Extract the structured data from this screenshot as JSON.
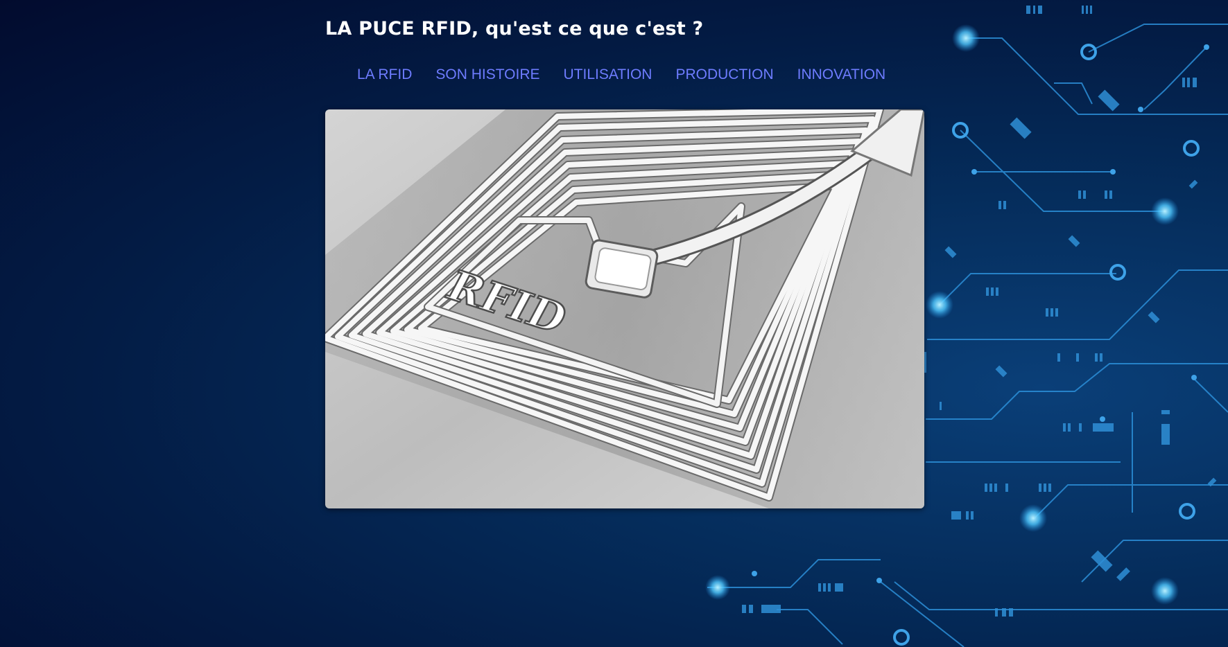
{
  "site": {
    "title": "LA PUCE RFID, qu'est ce que c'est ?"
  },
  "nav": {
    "items": [
      {
        "label": "LA RFID"
      },
      {
        "label": "SON HISTOIRE"
      },
      {
        "label": "UTILISATION"
      },
      {
        "label": "PRODUCTION"
      },
      {
        "label": "INNOVATION"
      }
    ]
  },
  "hero": {
    "tag_text": "RFID"
  },
  "colors": {
    "nav_link": "#6e7cff",
    "title": "#ffffff",
    "background_dark": "#020b2e",
    "circuit": "#2f8fd6"
  }
}
